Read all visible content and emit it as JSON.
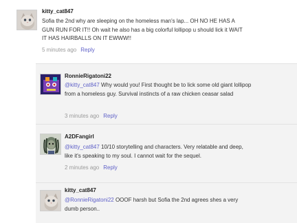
{
  "comments": [
    {
      "username": "kitty_cat847",
      "mention": "",
      "text": "Sofia the 2nd why are sleeping on the homeless man's lap... OH NO HE HAS A GUN RUN FOR IT!! Oh wait he also has a big colorful lollipop u should lick it WAIT IT HAS HAIRBALLS ON IT EWWW!!",
      "time": "5 minutes ago",
      "reply_label": "Reply"
    },
    {
      "username": "RonnieRigatoni22",
      "mention": "@kitty_cat847",
      "text": " Why would you! First thought be to lick some old giant lollipop from a homeless guy. Survival instincts of a raw chicken ceasar salad",
      "time": "3 minutes ago",
      "reply_label": "Reply"
    },
    {
      "username": "A2DFangirl",
      "mention": "@kitty_cat847",
      "text": " 10/10 storytelling and characters. Very relatable and deep, like it's speaking to my soul. I cannot wait for the sequel.",
      "time": "2 minutes ago",
      "reply_label": "Reply"
    },
    {
      "username": "kitty_cat847",
      "mention": "@RonnieRigatoni22",
      "text": " OOOF harsh but Sofia the 2nd agrees shes a very dumb person..",
      "time": "",
      "reply_label": ""
    }
  ],
  "icons": {
    "cat_avatar": "cat-avatar-icon",
    "robot_avatar": "robot-avatar-icon",
    "dreadlock_avatar": "character-avatar-icon"
  },
  "colors": {
    "link": "#5f61c8",
    "reply_bg": "#f3f3f3"
  }
}
